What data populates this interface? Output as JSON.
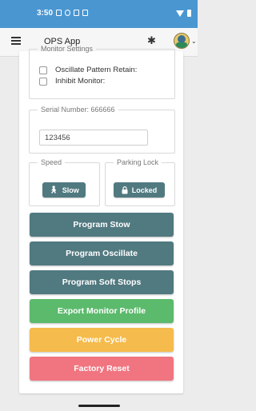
{
  "status_bar": {
    "time": "3:50"
  },
  "app_bar": {
    "title": "OPS App"
  },
  "monitor_settings": {
    "legend": "Monitor Settings",
    "options": [
      {
        "label": "Oscillate Pattern Retain:",
        "checked": false
      },
      {
        "label": "Inhibit Monitor:",
        "checked": false
      }
    ]
  },
  "serial": {
    "legend": "Serial Number: 666666",
    "value": "123456"
  },
  "speed": {
    "legend": "Speed",
    "button_label": "Slow"
  },
  "parking_lock": {
    "legend": "Parking Lock",
    "button_label": "Locked"
  },
  "actions": [
    {
      "label": "Program Stow",
      "color": "#517980"
    },
    {
      "label": "Program Oscillate",
      "color": "#517980"
    },
    {
      "label": "Program Soft Stops",
      "color": "#517980"
    },
    {
      "label": "Export Monitor Profile",
      "color": "#5cba6c"
    },
    {
      "label": "Power Cycle",
      "color": "#f5bb4c"
    },
    {
      "label": "Factory Reset",
      "color": "#f07580"
    }
  ]
}
